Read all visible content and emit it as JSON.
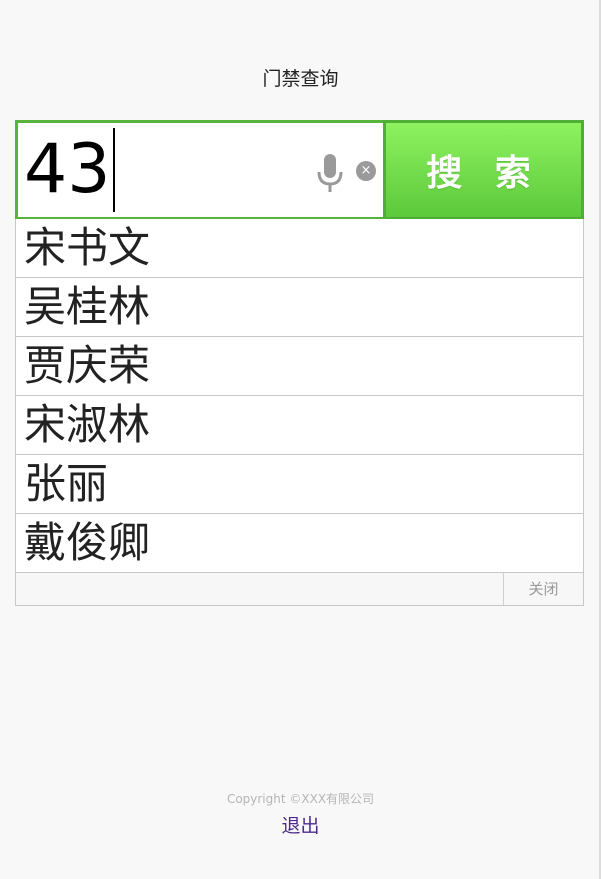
{
  "page": {
    "title": "门禁查询"
  },
  "search": {
    "value": "43",
    "button_label": "搜 索",
    "mic_icon": "microphone-icon",
    "clear_icon": "clear-icon",
    "clear_glyph": "×"
  },
  "results": {
    "items": [
      "宋书文",
      "吴桂林",
      "贾庆荣",
      "宋淑林",
      "张丽",
      "戴俊卿"
    ],
    "close_label": "关闭"
  },
  "footer": {
    "copyright": "Copyright ©XXX有限公司",
    "logout_label": "退出"
  },
  "colors": {
    "accent_green": "#57b33b",
    "button_green": "#6fd64a",
    "logout": "#4b2a8a"
  }
}
